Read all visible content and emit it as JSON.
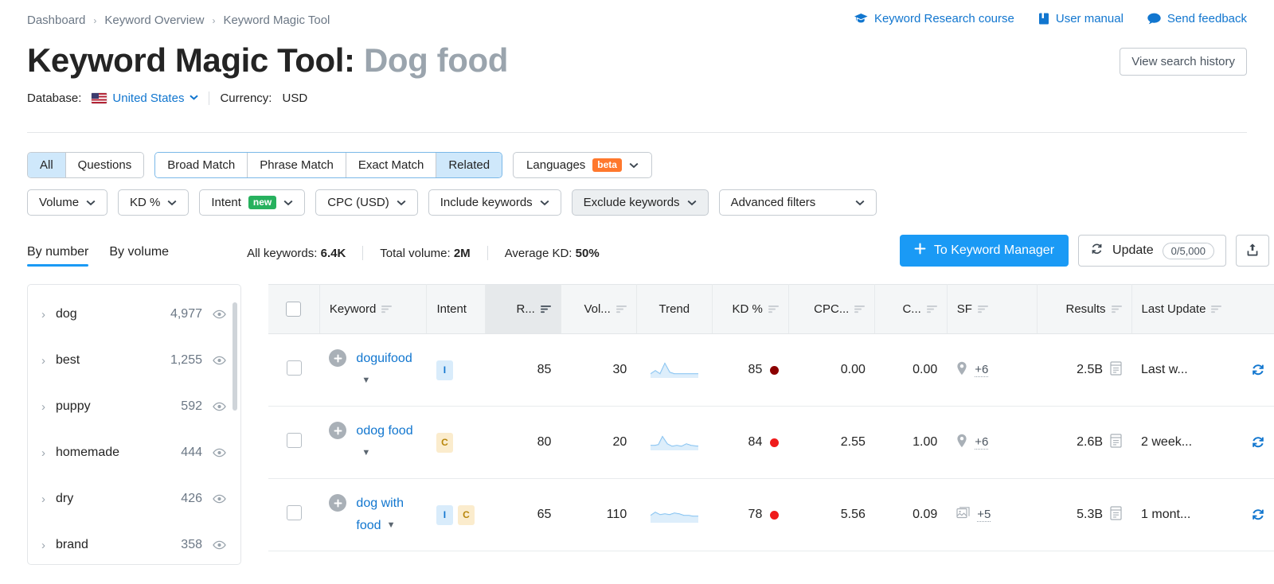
{
  "breadcrumb": [
    {
      "label": "Dashboard"
    },
    {
      "label": "Keyword Overview"
    },
    {
      "label": "Keyword Magic Tool"
    }
  ],
  "breadcrumb_separator": "›",
  "header_links": [
    {
      "label": "Keyword Research course",
      "icon": "graduation-cap-icon"
    },
    {
      "label": "User manual",
      "icon": "book-icon"
    },
    {
      "label": "Send feedback",
      "icon": "chat-bubble-icon"
    }
  ],
  "title": {
    "prefix": "Keyword Magic Tool:",
    "query": "Dog food"
  },
  "view_search_history_label": "View search history",
  "database": {
    "label": "Database:",
    "country": "United States",
    "currency_label": "Currency:",
    "currency_value": "USD"
  },
  "match_tabs": [
    {
      "label": "All",
      "active": true
    },
    {
      "label": "Questions",
      "active": false
    }
  ],
  "match_types": [
    {
      "label": "Broad Match",
      "active": false
    },
    {
      "label": "Phrase Match",
      "active": false
    },
    {
      "label": "Exact Match",
      "active": false
    },
    {
      "label": "Related",
      "active": true
    }
  ],
  "languages_filter": {
    "label": "Languages",
    "badge": "beta"
  },
  "filters": [
    {
      "label": "Volume",
      "badge": null,
      "active": false
    },
    {
      "label": "KD %",
      "badge": null,
      "active": false
    },
    {
      "label": "Intent",
      "badge": "new",
      "active": false
    },
    {
      "label": "CPC (USD)",
      "badge": null,
      "active": false
    },
    {
      "label": "Include keywords",
      "badge": null,
      "active": false
    },
    {
      "label": "Exclude keywords",
      "badge": null,
      "active": true
    },
    {
      "label": "Advanced filters",
      "badge": null,
      "active": false
    }
  ],
  "subtabs": [
    {
      "label": "By number",
      "active": true
    },
    {
      "label": "By volume",
      "active": false
    }
  ],
  "stats": [
    {
      "label": "All keywords:",
      "value": "6.4K"
    },
    {
      "label": "Total volume:",
      "value": "2M"
    },
    {
      "label": "Average KD:",
      "value": "50%"
    }
  ],
  "actions": {
    "to_keyword_manager": "To Keyword Manager",
    "plus_icon": "plus-icon",
    "update_label": "Update",
    "update_quota": "0/5,000",
    "update_icon": "refresh-icon",
    "export_icon": "export-icon"
  },
  "groups": [
    {
      "name": "dog",
      "count": "4,977"
    },
    {
      "name": "best",
      "count": "1,255"
    },
    {
      "name": "puppy",
      "count": "592"
    },
    {
      "name": "homemade",
      "count": "444"
    },
    {
      "name": "dry",
      "count": "426"
    },
    {
      "name": "brand",
      "count": "358"
    }
  ],
  "table": {
    "columns": [
      {
        "key": "check",
        "label": "",
        "sortable": false,
        "sorted": false,
        "align": "center"
      },
      {
        "key": "keyword",
        "label": "Keyword",
        "sortable": true,
        "sorted": false,
        "align": "left"
      },
      {
        "key": "intent",
        "label": "Intent",
        "sortable": false,
        "sorted": false,
        "align": "left"
      },
      {
        "key": "rank",
        "label": "R...",
        "sortable": true,
        "sorted": true,
        "align": "right"
      },
      {
        "key": "volume",
        "label": "Vol...",
        "sortable": true,
        "sorted": false,
        "align": "right"
      },
      {
        "key": "trend",
        "label": "Trend",
        "sortable": false,
        "sorted": false,
        "align": "center"
      },
      {
        "key": "kd",
        "label": "KD %",
        "sortable": true,
        "sorted": false,
        "align": "right"
      },
      {
        "key": "cpc",
        "label": "CPC...",
        "sortable": true,
        "sorted": false,
        "align": "right"
      },
      {
        "key": "com",
        "label": "C...",
        "sortable": true,
        "sorted": false,
        "align": "right"
      },
      {
        "key": "sf",
        "label": "SF",
        "sortable": true,
        "sorted": false,
        "align": "left"
      },
      {
        "key": "results",
        "label": "Results",
        "sortable": true,
        "sorted": false,
        "align": "right"
      },
      {
        "key": "updated",
        "label": "Last Update",
        "sortable": true,
        "sorted": false,
        "align": "left"
      }
    ],
    "rows": [
      {
        "keyword": "doguifood",
        "intents": [
          "I"
        ],
        "rank": "85",
        "volume": "30",
        "trend": "spike-early",
        "kd": "85",
        "kd_color": "#8b0000",
        "cpc": "0.00",
        "com": "0.00",
        "sf_icon": "map-pin-icon",
        "sf_more": "+6",
        "results": "2.5B",
        "results_icon": "serp-icon",
        "updated": "Last w...",
        "refresh_icon": "refresh-icon"
      },
      {
        "keyword": "odog food",
        "intents": [
          "C"
        ],
        "rank": "80",
        "volume": "20",
        "trend": "spike-mid",
        "kd": "84",
        "kd_color": "#ef1b1b",
        "cpc": "2.55",
        "com": "1.00",
        "sf_icon": "map-pin-icon",
        "sf_more": "+6",
        "results": "2.6B",
        "results_icon": "serp-icon",
        "updated": "2 week...",
        "refresh_icon": "refresh-icon"
      },
      {
        "keyword": "dog with food",
        "intents": [
          "I",
          "C"
        ],
        "rank": "65",
        "volume": "110",
        "trend": "flat-wave",
        "kd": "78",
        "kd_color": "#ef1b1b",
        "cpc": "5.56",
        "com": "0.09",
        "sf_icon": "image-icon",
        "sf_more": "+5",
        "results": "5.3B",
        "results_icon": "serp-icon",
        "updated": "1 mont...",
        "refresh_icon": "refresh-icon"
      }
    ]
  },
  "colors": {
    "accent_blue": "#1a9af5",
    "link_blue": "#1176cf",
    "active_tab_bg": "#cfe8fb",
    "beta_orange": "#ff782d",
    "new_green": "#27b15e"
  }
}
